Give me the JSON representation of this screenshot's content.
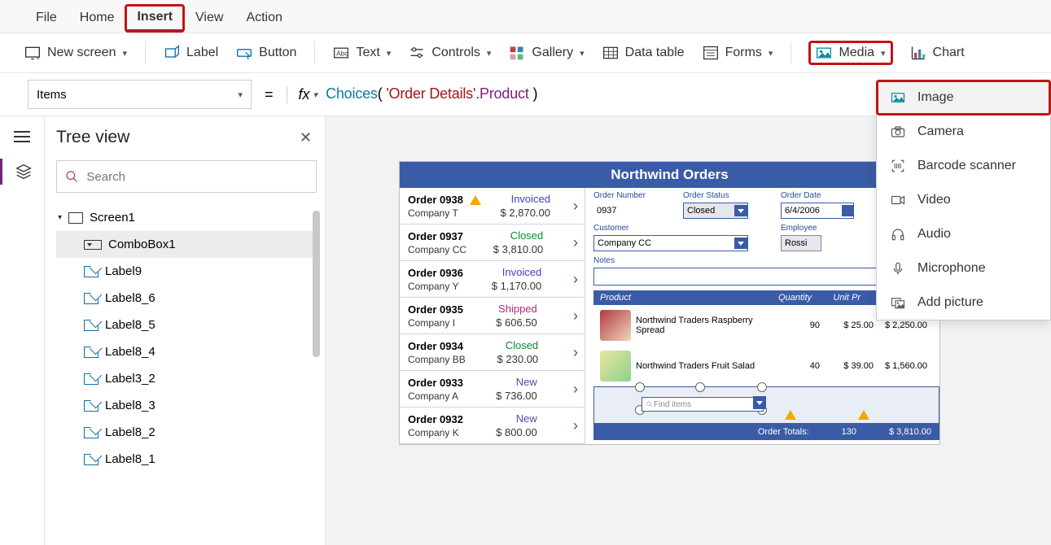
{
  "menu": {
    "items": [
      "File",
      "Home",
      "Insert",
      "View",
      "Action"
    ],
    "active_index": 2
  },
  "toolbar": {
    "new_screen": "New screen",
    "label": "Label",
    "button": "Button",
    "text": "Text",
    "controls": "Controls",
    "gallery": "Gallery",
    "data_table": "Data table",
    "forms": "Forms",
    "media": "Media",
    "chart": "Chart"
  },
  "formula_bar": {
    "property": "Items",
    "equals": "=",
    "fx_label": "fx",
    "formula_fn": "Choices",
    "formula_arg_str": "'Order Details'",
    "formula_prop": ".Product",
    "raw": "Choices( 'Order Details'.Product )"
  },
  "tree": {
    "panel_title": "Tree view",
    "search_placeholder": "Search",
    "root": "Screen1",
    "selected": "ComboBox1",
    "items": [
      "ComboBox1",
      "Label9",
      "Label8_6",
      "Label8_5",
      "Label8_4",
      "Label3_2",
      "Label8_3",
      "Label8_2",
      "Label8_1"
    ]
  },
  "app": {
    "title": "Northwind Orders",
    "orders": [
      {
        "name": "Order 0938",
        "company": "Company T",
        "status": "Invoiced",
        "status_cls": "invoiced",
        "amount": "$ 2,870.00",
        "warn": true
      },
      {
        "name": "Order 0937",
        "company": "Company CC",
        "status": "Closed",
        "status_cls": "closed",
        "amount": "$ 3,810.00"
      },
      {
        "name": "Order 0936",
        "company": "Company Y",
        "status": "Invoiced",
        "status_cls": "invoiced",
        "amount": "$ 1,170.00"
      },
      {
        "name": "Order 0935",
        "company": "Company I",
        "status": "Shipped",
        "status_cls": "shipped",
        "amount": "$ 606.50"
      },
      {
        "name": "Order 0934",
        "company": "Company BB",
        "status": "Closed",
        "status_cls": "closed",
        "amount": "$ 230.00"
      },
      {
        "name": "Order 0933",
        "company": "Company A",
        "status": "New",
        "status_cls": "new",
        "amount": "$ 736.00"
      },
      {
        "name": "Order 0932",
        "company": "Company K",
        "status": "New",
        "status_cls": "new",
        "amount": "$ 800.00"
      }
    ],
    "detail": {
      "labels": {
        "order_number": "Order Number",
        "order_status": "Order Status",
        "order_date": "Order Date",
        "customer": "Customer",
        "employee": "Employee",
        "notes": "Notes"
      },
      "values": {
        "order_number": "0937",
        "order_status": "Closed",
        "order_date": "6/4/2006",
        "customer": "Company CC",
        "employee": "Rossi"
      },
      "table_headers": {
        "product": "Product",
        "quantity": "Quantity",
        "unit_price": "Unit Pr"
      },
      "products": [
        {
          "name": "Northwind Traders Raspberry Spread",
          "qty": "90",
          "price": "$ 25.00",
          "total": "$ 2,250.00",
          "thumb": "raspberry"
        },
        {
          "name": "Northwind Traders Fruit Salad",
          "qty": "40",
          "price": "$ 39.00",
          "total": "$ 1,560.00",
          "thumb": "salad"
        }
      ],
      "combo_placeholder": "Find items",
      "totals": {
        "label": "Order Totals:",
        "qty": "130",
        "amount": "$ 3,810.00"
      }
    }
  },
  "media_menu": {
    "items": [
      "Image",
      "Camera",
      "Barcode scanner",
      "Video",
      "Audio",
      "Microphone",
      "Add picture"
    ],
    "highlighted_index": 0
  }
}
